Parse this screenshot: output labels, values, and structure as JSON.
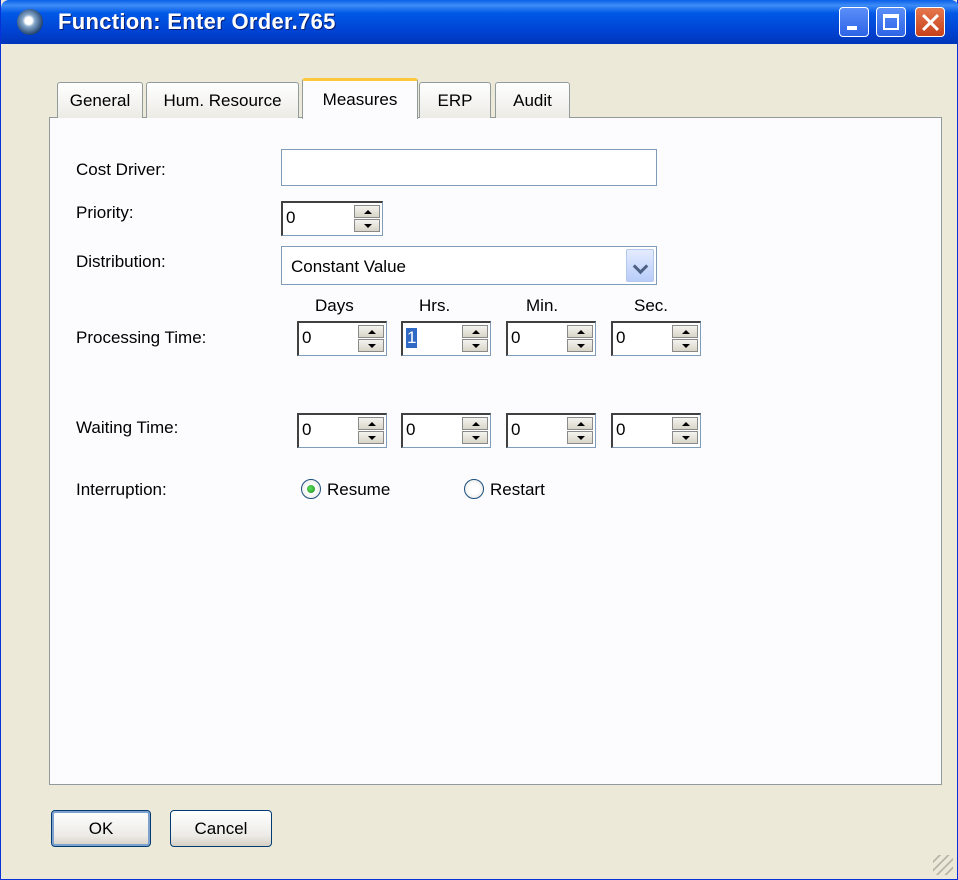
{
  "window": {
    "title": "Function: Enter Order.765"
  },
  "tabs": [
    {
      "label": "General"
    },
    {
      "label": "Hum. Resource"
    },
    {
      "label": "Measures"
    },
    {
      "label": "ERP"
    },
    {
      "label": "Audit"
    }
  ],
  "active_tab": "Measures",
  "form": {
    "cost_driver": {
      "label": "Cost Driver:",
      "value": ""
    },
    "priority": {
      "label": "Priority:",
      "value": "0"
    },
    "distribution": {
      "label": "Distribution:",
      "value": "Constant Value"
    },
    "time_units": [
      "Days",
      "Hrs.",
      "Min.",
      "Sec."
    ],
    "processing_time": {
      "label": "Processing Time:",
      "values": [
        "0",
        "1",
        "0",
        "0"
      ]
    },
    "waiting_time": {
      "label": "Waiting Time:",
      "values": [
        "0",
        "0",
        "0",
        "0"
      ]
    },
    "interruption": {
      "label": "Interruption:",
      "options": [
        {
          "label": "Resume",
          "checked": true
        },
        {
          "label": "Restart",
          "checked": false
        }
      ]
    }
  },
  "buttons": {
    "ok": "OK",
    "cancel": "Cancel"
  },
  "icons": [
    "app-icon",
    "minimize-icon",
    "maximize-icon",
    "close-icon",
    "dropdown-arrow-icon",
    "size-grip-icon"
  ]
}
